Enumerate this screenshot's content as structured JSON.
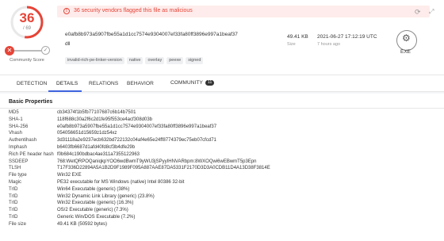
{
  "score": {
    "detections": "36",
    "total": "/ 69"
  },
  "community": {
    "label": "Community Score",
    "x_glyph": "✕",
    "ok_glyph": "✓"
  },
  "alert": {
    "text": "36 security vendors flagged this file as malicious"
  },
  "file": {
    "sha256": "e0afb8b973a5907fbe55a1d1cc7574e9304007ef33fa80ff3896e997a1beaf37",
    "name": "dll",
    "tags": [
      "invalid-rich-pe-linker-version",
      "native",
      "overlay",
      "peexe",
      "signed"
    ],
    "size": "49.41 KB",
    "size_label": "Size",
    "date": "2021-06-27 17:12:19 UTC",
    "date_label": "7 hours ago",
    "type_label": "EXE"
  },
  "tabs": [
    {
      "label": "DETECTION"
    },
    {
      "label": "DETAILS"
    },
    {
      "label": "RELATIONS"
    },
    {
      "label": "BEHAVIOR"
    },
    {
      "label": "COMMUNITY",
      "badge": "11"
    }
  ],
  "section": {
    "title": "Basic Properties"
  },
  "properties": [
    {
      "k": "MD5",
      "v": "cb34374f1b5fb77107687c6b14b7501"
    },
    {
      "k": "SHA-1",
      "v": "118f688c30a2f6c2d1fe95f553ce4acf308d03b"
    },
    {
      "k": "SHA-256",
      "v": "e0afb8b973a5907fbe55a1d1cc7574e9304007ef33fa80ff3896e997a1beaf37"
    },
    {
      "k": "Vhash",
      "v": "054056651d15659z1dz54xz"
    },
    {
      "k": "Authentihash",
      "v": "3d31118a2e9237ecb632bd722132c04af4e65e24ff8774379ec75eb07cfcd71"
    },
    {
      "k": "Imphash",
      "v": "b6403fb6687d1afd40fd8cf3b4dfe29b"
    },
    {
      "k": "Rich PE header hash",
      "v": "f0b684c190bdbac4ae311a7355122963"
    },
    {
      "k": "SSDEEP",
      "v": "768:WetQRPOQaniqkpYOO6wdBwmT9yWU3jSPyyIHNVARbpm:8WXOQwi6wEBwmT5p3Epn"
    },
    {
      "k": "TLSH",
      "v": "T17F336D22894A5A1B2D9F1989F095A887AAE87DA5331F2170D3D3A0CDB11D4A13D38F3814E"
    },
    {
      "k": "File type",
      "v": "Win32 EXE"
    },
    {
      "k": "Magic",
      "v": "PE32 executable for MS Windows (native) Intel 80386 32-bit"
    },
    {
      "k": "TrID",
      "v": "Win64 Executable (generic) (38%)"
    },
    {
      "k": "TrID",
      "v": "Win32 Dynamic Link Library (generic) (23.8%)"
    },
    {
      "k": "TrID",
      "v": "Win32 Executable (generic) (16.3%)"
    },
    {
      "k": "TrID",
      "v": "OS/2 Executable (generic) (7.3%)"
    },
    {
      "k": "TrID",
      "v": "Generic Win/DOS Executable (7.2%)"
    },
    {
      "k": "File size",
      "v": "49.41 KB (50592 bytes)"
    }
  ],
  "colors": {
    "malicious": "#e64437",
    "accent": "#3d63dd",
    "alert_bg": "#fdeceb"
  },
  "icons": {
    "refresh": "refresh-icon",
    "expand": "expand-icon",
    "alert": "alert-circle-icon",
    "filetype": "exe-gear-icon"
  }
}
